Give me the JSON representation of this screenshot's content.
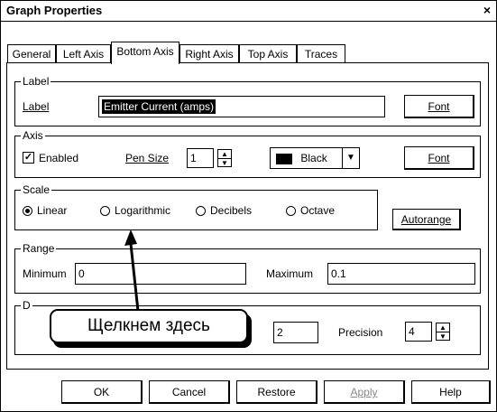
{
  "window": {
    "title": "Graph Properties",
    "close_glyph": "×"
  },
  "tabs": [
    "General",
    "Left Axis",
    "Bottom Axis",
    "Right Axis",
    "Top Axis",
    "Traces"
  ],
  "active_tab": "Bottom Axis",
  "label_group": {
    "title": "Label",
    "field_label": "Label",
    "value": "Emitter Current (amps)",
    "font_button": "Font"
  },
  "axis_group": {
    "title": "Axis",
    "enabled_label": "Enabled",
    "enabled_checked": true,
    "pen_size_label": "Pen Size",
    "pen_size_value": "1",
    "color_value": "Black",
    "font_button": "Font"
  },
  "scale_group": {
    "title": "Scale",
    "options": [
      "Linear",
      "Logarithmic",
      "Decibels",
      "Octave"
    ],
    "selected": "Linear",
    "autorange_button": "Autorange"
  },
  "range_group": {
    "title": "Range",
    "minimum_label": "Minimum",
    "minimum_value": "0",
    "maximum_label": "Maximum",
    "maximum_value": "0.1"
  },
  "format_group": {
    "title": "D",
    "value_field": "2",
    "precision_label": "Precision",
    "precision_value": "4"
  },
  "buttons": {
    "ok": "OK",
    "cancel": "Cancel",
    "restore": "Restore",
    "apply": "Apply",
    "help": "Help"
  },
  "callout": {
    "text": "Щелкнем здесь"
  }
}
